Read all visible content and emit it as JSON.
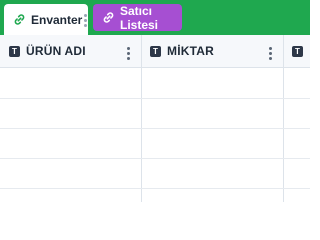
{
  "tabs": [
    {
      "label": "Envanter",
      "active": true,
      "icon": "link-icon"
    },
    {
      "label": "Satıcı Listesi",
      "active": false,
      "icon": "link-icon"
    }
  ],
  "table": {
    "columns": [
      {
        "label": "ÜRÜN ADI",
        "type_icon": "T"
      },
      {
        "label": "MİKTAR",
        "type_icon": "T"
      },
      {
        "label": "",
        "type_icon": "T"
      }
    ],
    "rows": [
      [
        "",
        "",
        ""
      ],
      [
        "",
        "",
        ""
      ],
      [
        "",
        "",
        ""
      ],
      [
        "",
        "",
        ""
      ],
      [
        "",
        "",
        ""
      ]
    ]
  },
  "colors": {
    "tabbar": "#1fa84f",
    "inactive_tab": "#a64fd2",
    "header_bg": "#f6f8fb"
  }
}
